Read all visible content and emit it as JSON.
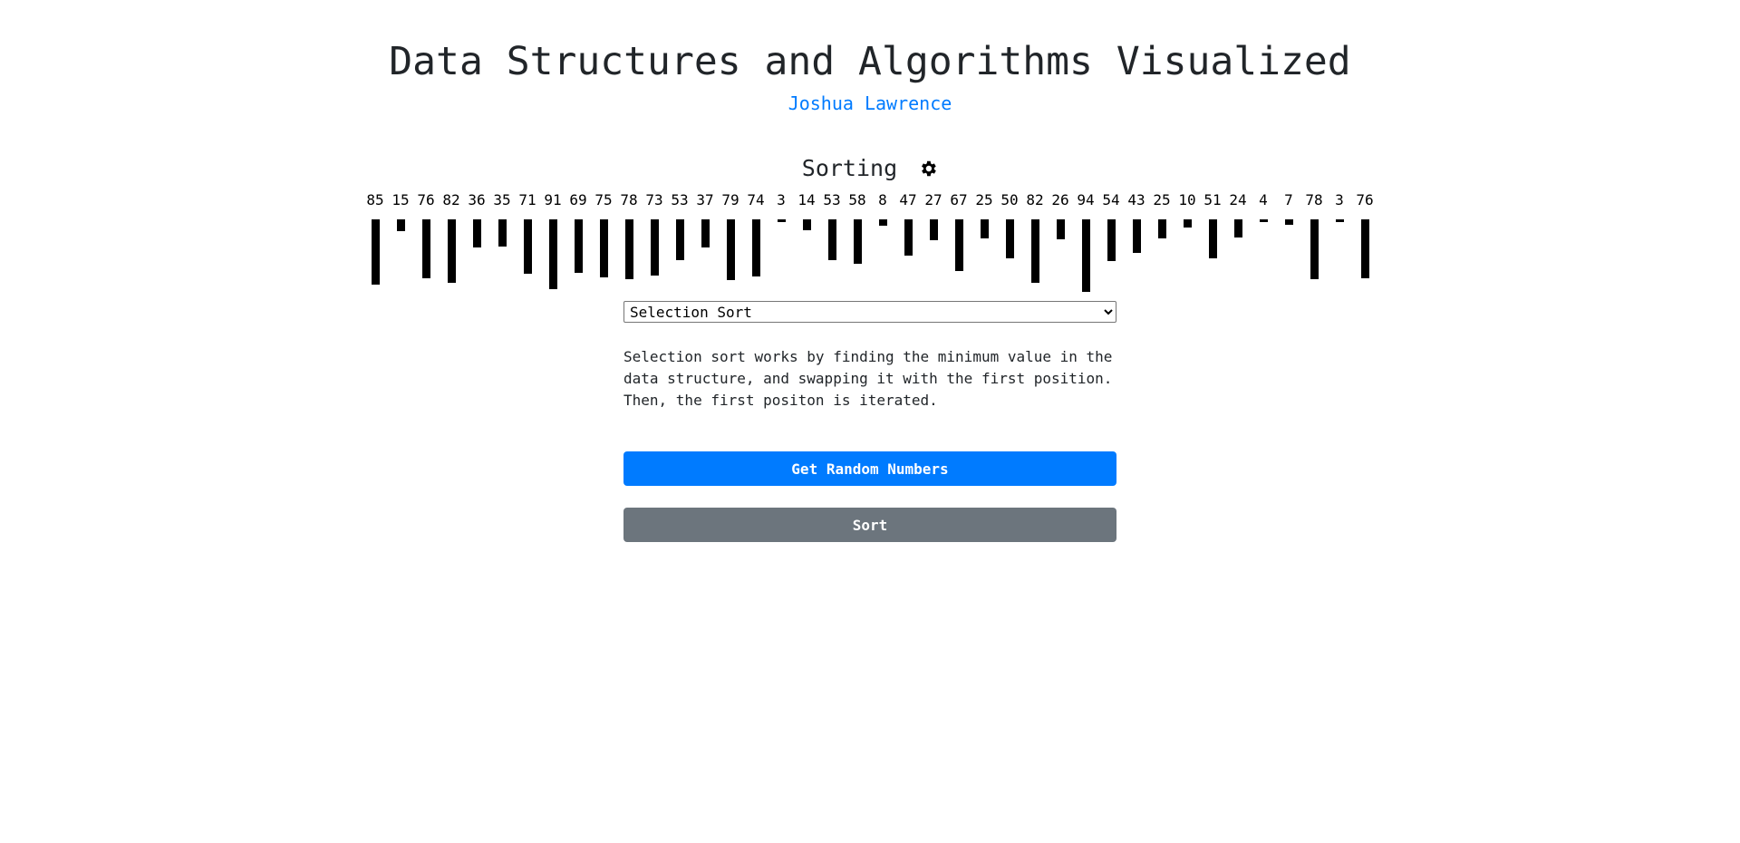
{
  "header": {
    "title": "Data Structures and Algorithms Visualized",
    "author": "Joshua Lawrence"
  },
  "section": {
    "title": "Sorting",
    "settings_icon": "gear-icon"
  },
  "numbers": [
    85,
    15,
    76,
    82,
    36,
    35,
    71,
    91,
    69,
    75,
    78,
    73,
    53,
    37,
    79,
    74,
    3,
    14,
    53,
    58,
    8,
    47,
    27,
    67,
    25,
    50,
    82,
    26,
    94,
    54,
    43,
    25,
    10,
    51,
    24,
    4,
    7,
    78,
    3,
    76
  ],
  "algorithm_select": {
    "selected": "Selection Sort"
  },
  "description": "Selection sort works by finding the minimum value in the data structure, and swapping it with the first position. Then, the first positon is iterated.",
  "buttons": {
    "random_label": "Get Random Numbers",
    "sort_label": "Sort"
  },
  "colors": {
    "primary": "#007bff",
    "secondary": "#6c757d",
    "bar": "#000000"
  }
}
